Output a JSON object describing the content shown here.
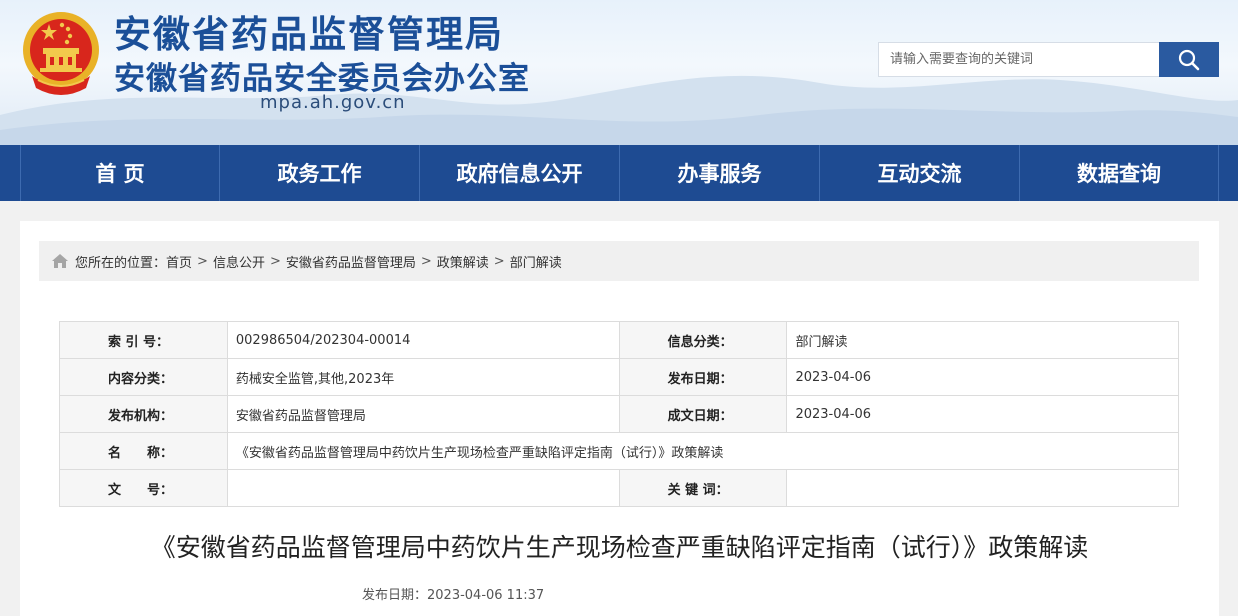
{
  "header": {
    "title_main": "安徽省药品监督管理局",
    "title_sub": "安徽省药品安全委员会办公室",
    "domain": "mpa.ah.gov.cn",
    "search_placeholder": "请输入需要查询的关键词"
  },
  "nav": {
    "items": [
      "首 页",
      "政务工作",
      "政府信息公开",
      "办事服务",
      "互动交流",
      "数据查询"
    ]
  },
  "breadcrumb": {
    "prefix": "您所在的位置：",
    "items": [
      "首页",
      "信息公开",
      "安徽省药品监督管理局",
      "政策解读",
      "部门解读"
    ],
    "separator": ">"
  },
  "info_table": {
    "index_label": "索 引 号：",
    "index_value": "002986504/202304-00014",
    "category_label": "信息分类：",
    "category_value": "部门解读",
    "content_type_label": "内容分类：",
    "content_type_value": "药械安全监管,其他,2023年",
    "publish_date_label": "发布日期：",
    "publish_date_value": "2023-04-06",
    "publisher_label": "发布机构：",
    "publisher_value": "安徽省药品监督管理局",
    "created_date_label": "成文日期：",
    "created_date_value": "2023-04-06",
    "name_label": "名　　称：",
    "name_value": "《安徽省药品监督管理局中药饮片生产现场检查严重缺陷评定指南（试行）》政策解读",
    "doc_no_label": "文　　号：",
    "doc_no_value": "",
    "keywords_label": "关 键 词：",
    "keywords_value": ""
  },
  "article": {
    "title": "《安徽省药品监督管理局中药饮片生产现场检查严重缺陷评定指南（试行）》政策解读",
    "publish_time": "发布日期：2023-04-06 11:37"
  },
  "colors": {
    "brand_blue": "#1e4b92",
    "title_blue": "#1b4f98",
    "search_button": "#2a5aa0"
  }
}
